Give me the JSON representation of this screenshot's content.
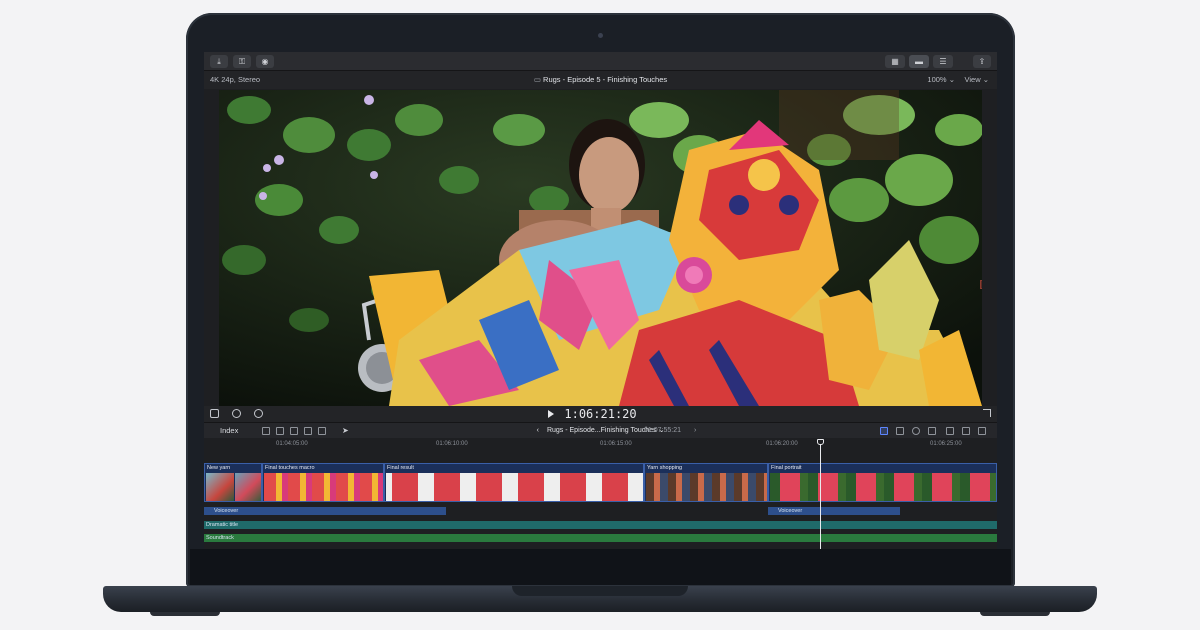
{
  "toolbar": {
    "import_icon": "download-arrow-icon",
    "keyword_icon": "key-icon",
    "background_task_icon": "check-circle-icon",
    "layout_icons": [
      "grid-icon",
      "filmstrip-icon",
      "inspector-icon"
    ],
    "share_icon": "share-icon"
  },
  "viewer_bar": {
    "format": "4K 24p, Stereo",
    "title": "Rugs - Episode 5 - Finishing Touches",
    "zoom": "100%",
    "view": "View"
  },
  "transport": {
    "timecode": "1:06:21:20"
  },
  "timeline": {
    "index_label": "Index",
    "project_title": "Rugs - Episode...Finishing Touches",
    "duration": "01:07:55:21",
    "ruler_ticks": [
      "01:04:05:00",
      "01:06:10:00",
      "01:06:15:00",
      "01:06:20:00",
      "01:06:25:00"
    ],
    "clips": [
      {
        "label": "New yarn"
      },
      {
        "label": "Final touches macro"
      },
      {
        "label": "Final result"
      },
      {
        "label": "Yarn shopping"
      },
      {
        "label": "Final portrait"
      }
    ],
    "audio": {
      "voiceover_1": "Voiceover",
      "voiceover_2": "Voiceover",
      "music": "Dramatic title",
      "soundtrack": "Soundtrack"
    }
  },
  "colors": {
    "clip_blue": "#1b2f5a",
    "voiceover_blue": "#2d4f8c",
    "music_teal": "#1f6a6a",
    "soundtrack_green": "#2a7a3e"
  }
}
